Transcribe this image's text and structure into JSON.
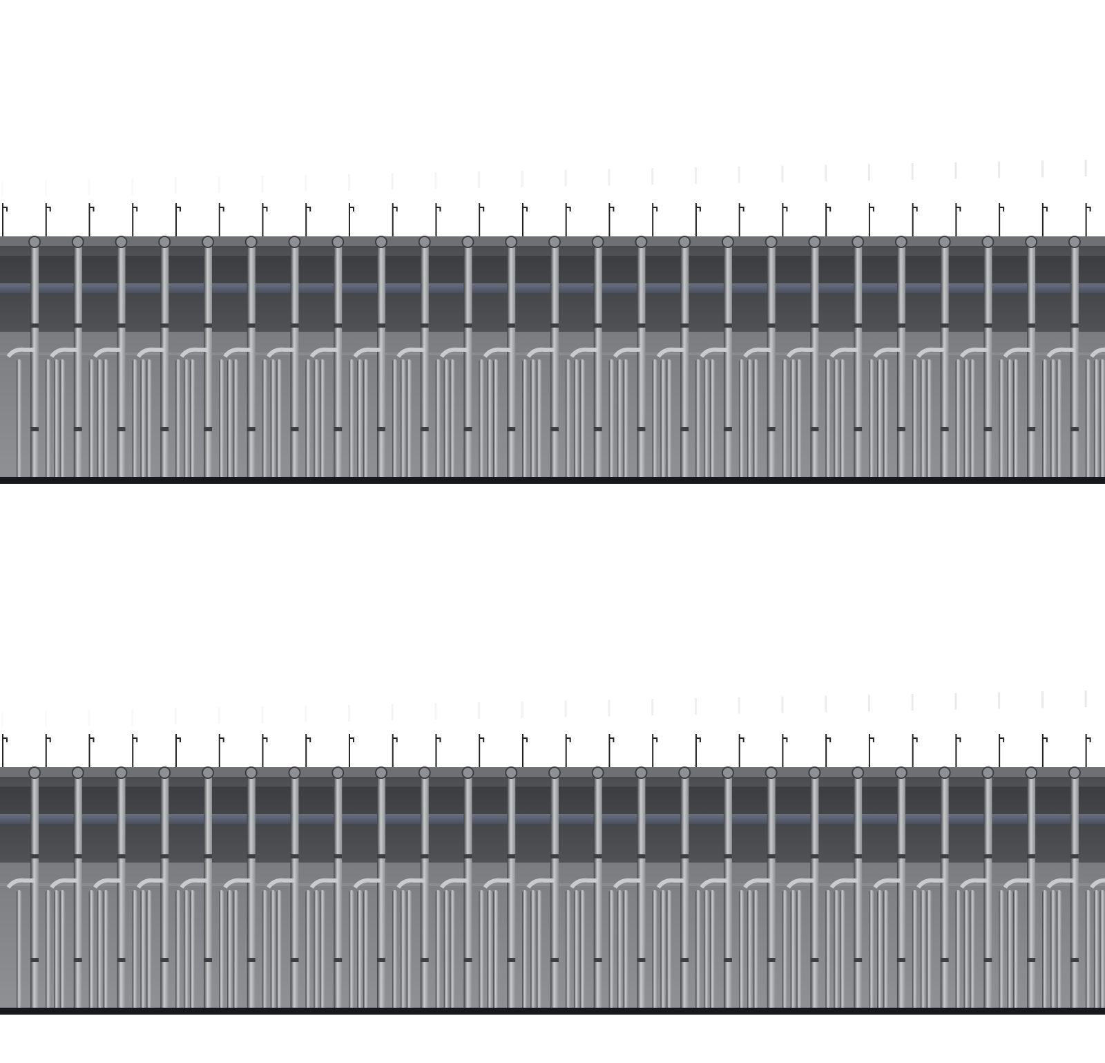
{
  "sprite_sheet": {
    "background": "#ffffff",
    "strips": [
      {
        "id": "strip-top",
        "tile_count": 26,
        "motion_blur": true
      },
      {
        "id": "strip-bottom",
        "tile_count": 26,
        "motion_blur": true
      }
    ]
  },
  "colors": {
    "frame_dark": "#2b2d31",
    "frame_top": "#6e7073",
    "frame_mid": "#4a4c50",
    "pipe_light": "#c9cbcd",
    "pipe_mid": "#8d9094",
    "pipe_dark": "#3c3e42",
    "crossbar": "#4b5060",
    "floor": "#8f9194",
    "floor_dark": "#7a7c80",
    "base_black": "#16181c",
    "base_rail": "#55575b",
    "base_grate": "#6a6c6f",
    "hook": "#222222"
  },
  "icons": [
    "hook-icon",
    "pipe-icon",
    "valve-icon"
  ]
}
